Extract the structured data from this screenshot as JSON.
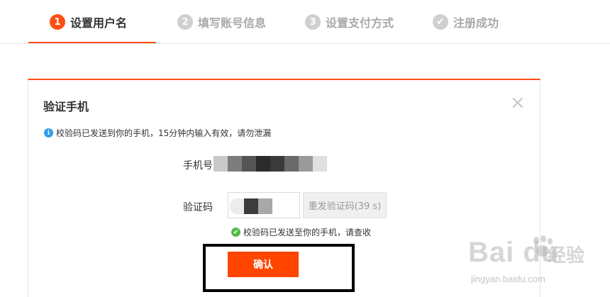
{
  "steps": [
    {
      "number": "1",
      "label": "设置用户名",
      "active": true
    },
    {
      "number": "2",
      "label": "填写账号信息",
      "active": false
    },
    {
      "number": "3",
      "label": "设置支付方式",
      "active": false
    },
    {
      "number": "✔",
      "label": "注册成功",
      "active": false
    }
  ],
  "dialog": {
    "title": "验证手机",
    "close_symbol": "×",
    "notice": "校验码已发送到你的手机，15分钟内输入有效，请勿泄漏",
    "phone_label": "手机号",
    "code_label": "验证码",
    "resend_label": "重发验证码(39 s)",
    "sent_message": "校验码已发送至你的手机，请查收",
    "confirm_label": "确认"
  },
  "watermark": {
    "logo": "Bai du",
    "cn": "经验",
    "url": "jingyan.baidu.com"
  },
  "colors": {
    "accent": "#ff4f14",
    "confirm": "#ff4500",
    "info": "#2e9fe8",
    "success": "#56b94a"
  }
}
